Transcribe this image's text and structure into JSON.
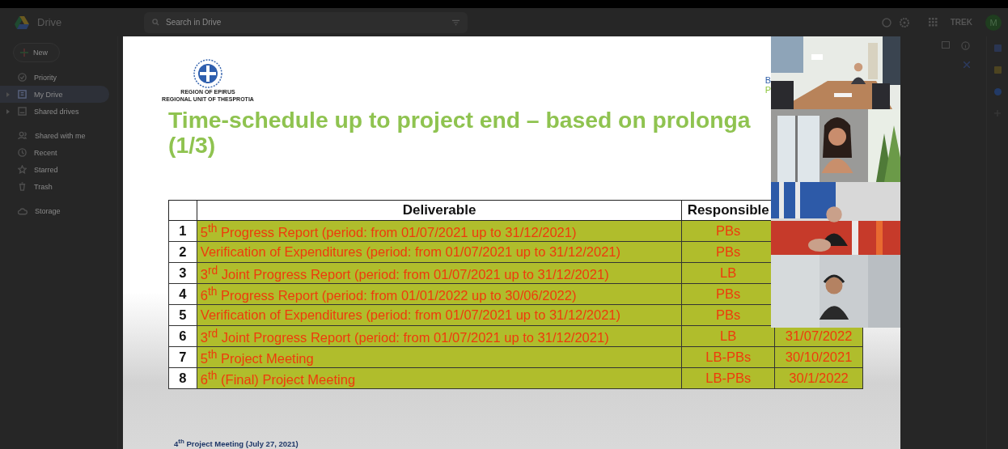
{
  "drive": {
    "app_name": "Drive",
    "search": {
      "placeholder": "Search in Drive"
    },
    "account_logo": "TREK",
    "avatar": "M",
    "new_button": "New",
    "sidebar": {
      "items": [
        {
          "label": "Priority",
          "kind": "check",
          "selected": false,
          "expandable": false
        },
        {
          "label": "My Drive",
          "kind": "drive",
          "selected": true,
          "expandable": true
        },
        {
          "label": "Shared drives",
          "kind": "shared-drive",
          "selected": false,
          "expandable": true
        },
        {
          "label": "Shared with me",
          "kind": "people",
          "selected": false,
          "expandable": false
        },
        {
          "label": "Recent",
          "kind": "clock",
          "selected": false,
          "expandable": false
        },
        {
          "label": "Starred",
          "kind": "star",
          "selected": false,
          "expandable": false
        },
        {
          "label": "Trash",
          "kind": "trash",
          "selected": false,
          "expandable": false
        },
        {
          "label": "Storage",
          "kind": "cloud",
          "selected": false,
          "expandable": false
        }
      ]
    }
  },
  "slide": {
    "org_lines": [
      "REGION OF EPIRUS",
      "REGIONAL UNIT OF THESPROTIA"
    ],
    "partner_logo_fragments": [
      "B",
      "P"
    ],
    "title_lines": [
      "Time-schedule up to project end – based on prolonga",
      "(1/3)"
    ],
    "table": {
      "columns": [
        "Deliverable",
        "Responsible"
      ],
      "rows": [
        {
          "number": "1",
          "deliverable": "5$^{th}$ Progress Report (period: from 01/07/2021 up to 31/12/2021)",
          "responsible": "PBs"
        },
        {
          "number": "2",
          "deliverable": "Verification of Expenditures (period: from 01/07/2021 up to 31/12/2021)",
          "responsible": "PBs"
        },
        {
          "number": "3",
          "deliverable": "3$^{rd}$ Joint Progress Report (period: from 01/07/2021 up to 31/12/2021)",
          "responsible": "LB"
        },
        {
          "number": "4",
          "deliverable": "6$^{th}$ Progress Report (period: from 01/01/2022 up to 30/06/2022)",
          "responsible": "PBs"
        },
        {
          "number": "5",
          "deliverable": "Verification of Expenditures (period: from 01/07/2021 up to 31/12/2021)",
          "responsible": "PBs"
        },
        {
          "number": "6",
          "deliverable": "3$^{rd}$ Joint Progress Report (period: from 01/07/2021 up to 31/12/2021)",
          "responsible": "LB",
          "deadline": "31/07/2022"
        },
        {
          "number": "7",
          "deliverable": "5$^{th}$ Project Meeting",
          "responsible": "LB-PBs",
          "deadline": "30/10/2021"
        },
        {
          "number": "8",
          "deliverable": "6$^{th}$ (Final) Project Meeting",
          "responsible": "LB-PBs",
          "deadline": "30/1/2022"
        }
      ]
    },
    "footer": "4$^{th}$ Project Meeting (July 27, 2021)"
  }
}
